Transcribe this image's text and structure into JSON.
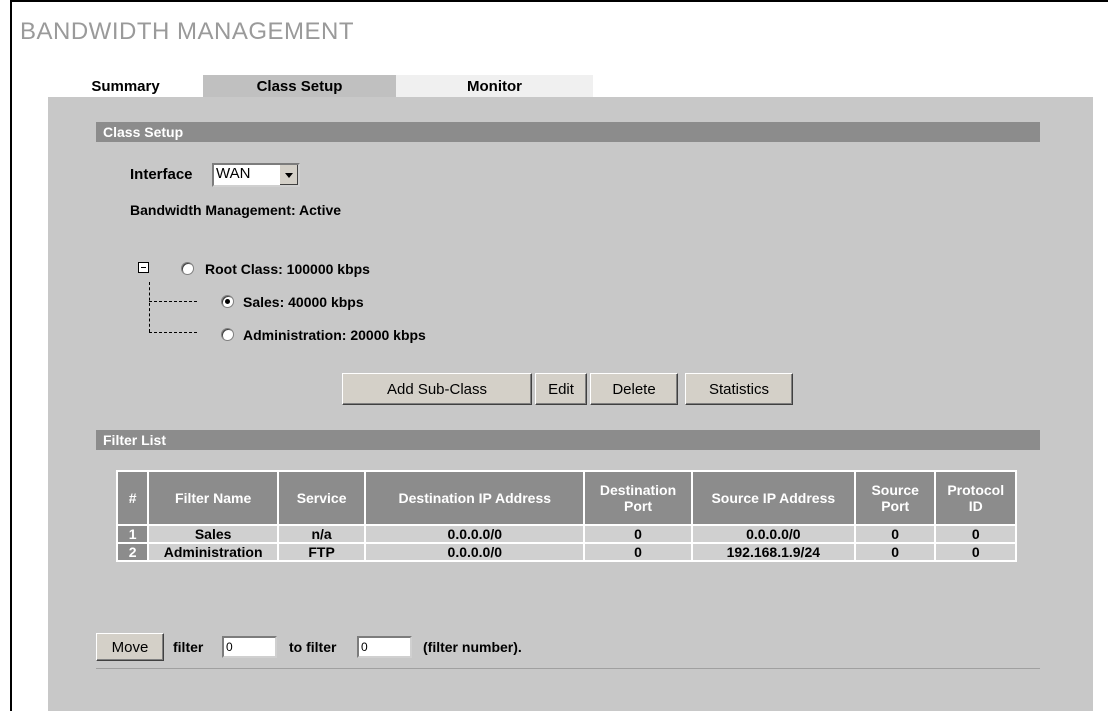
{
  "page": {
    "title": "BANDWIDTH MANAGEMENT"
  },
  "tabs": [
    {
      "label": "Summary"
    },
    {
      "label": "Class Setup",
      "active": true
    },
    {
      "label": "Monitor"
    }
  ],
  "class_setup": {
    "section_title": "Class Setup",
    "interface_label": "Interface",
    "interface_value": "WAN",
    "status_text": "Bandwidth Management: Active",
    "tree": [
      {
        "label": "Root Class: 100000 kbps",
        "selected": false
      },
      {
        "label": "Sales: 40000 kbps",
        "selected": true
      },
      {
        "label": "Administration: 20000 kbps",
        "selected": false
      }
    ],
    "buttons": {
      "add_sub_class": "Add Sub-Class",
      "edit": "Edit",
      "delete": "Delete",
      "statistics": "Statistics"
    }
  },
  "filter_list": {
    "section_title": "Filter List",
    "columns": [
      "#",
      "Filter Name",
      "Service",
      "Destination IP Address",
      "Destination Port",
      "Source IP Address",
      "Source Port",
      "Protocol ID"
    ],
    "rows": [
      [
        "1",
        "Sales",
        "n/a",
        "0.0.0.0/0",
        "0",
        "0.0.0.0/0",
        "0",
        "0"
      ],
      [
        "2",
        "Administration",
        "FTP",
        "0.0.0.0/0",
        "0",
        "192.168.1.9/24",
        "0",
        "0"
      ]
    ]
  },
  "move": {
    "button": "Move",
    "filter_label": "filter",
    "filter_value": "0",
    "to_label": "to filter",
    "to_value": "0",
    "suffix": "(filter number)."
  }
}
